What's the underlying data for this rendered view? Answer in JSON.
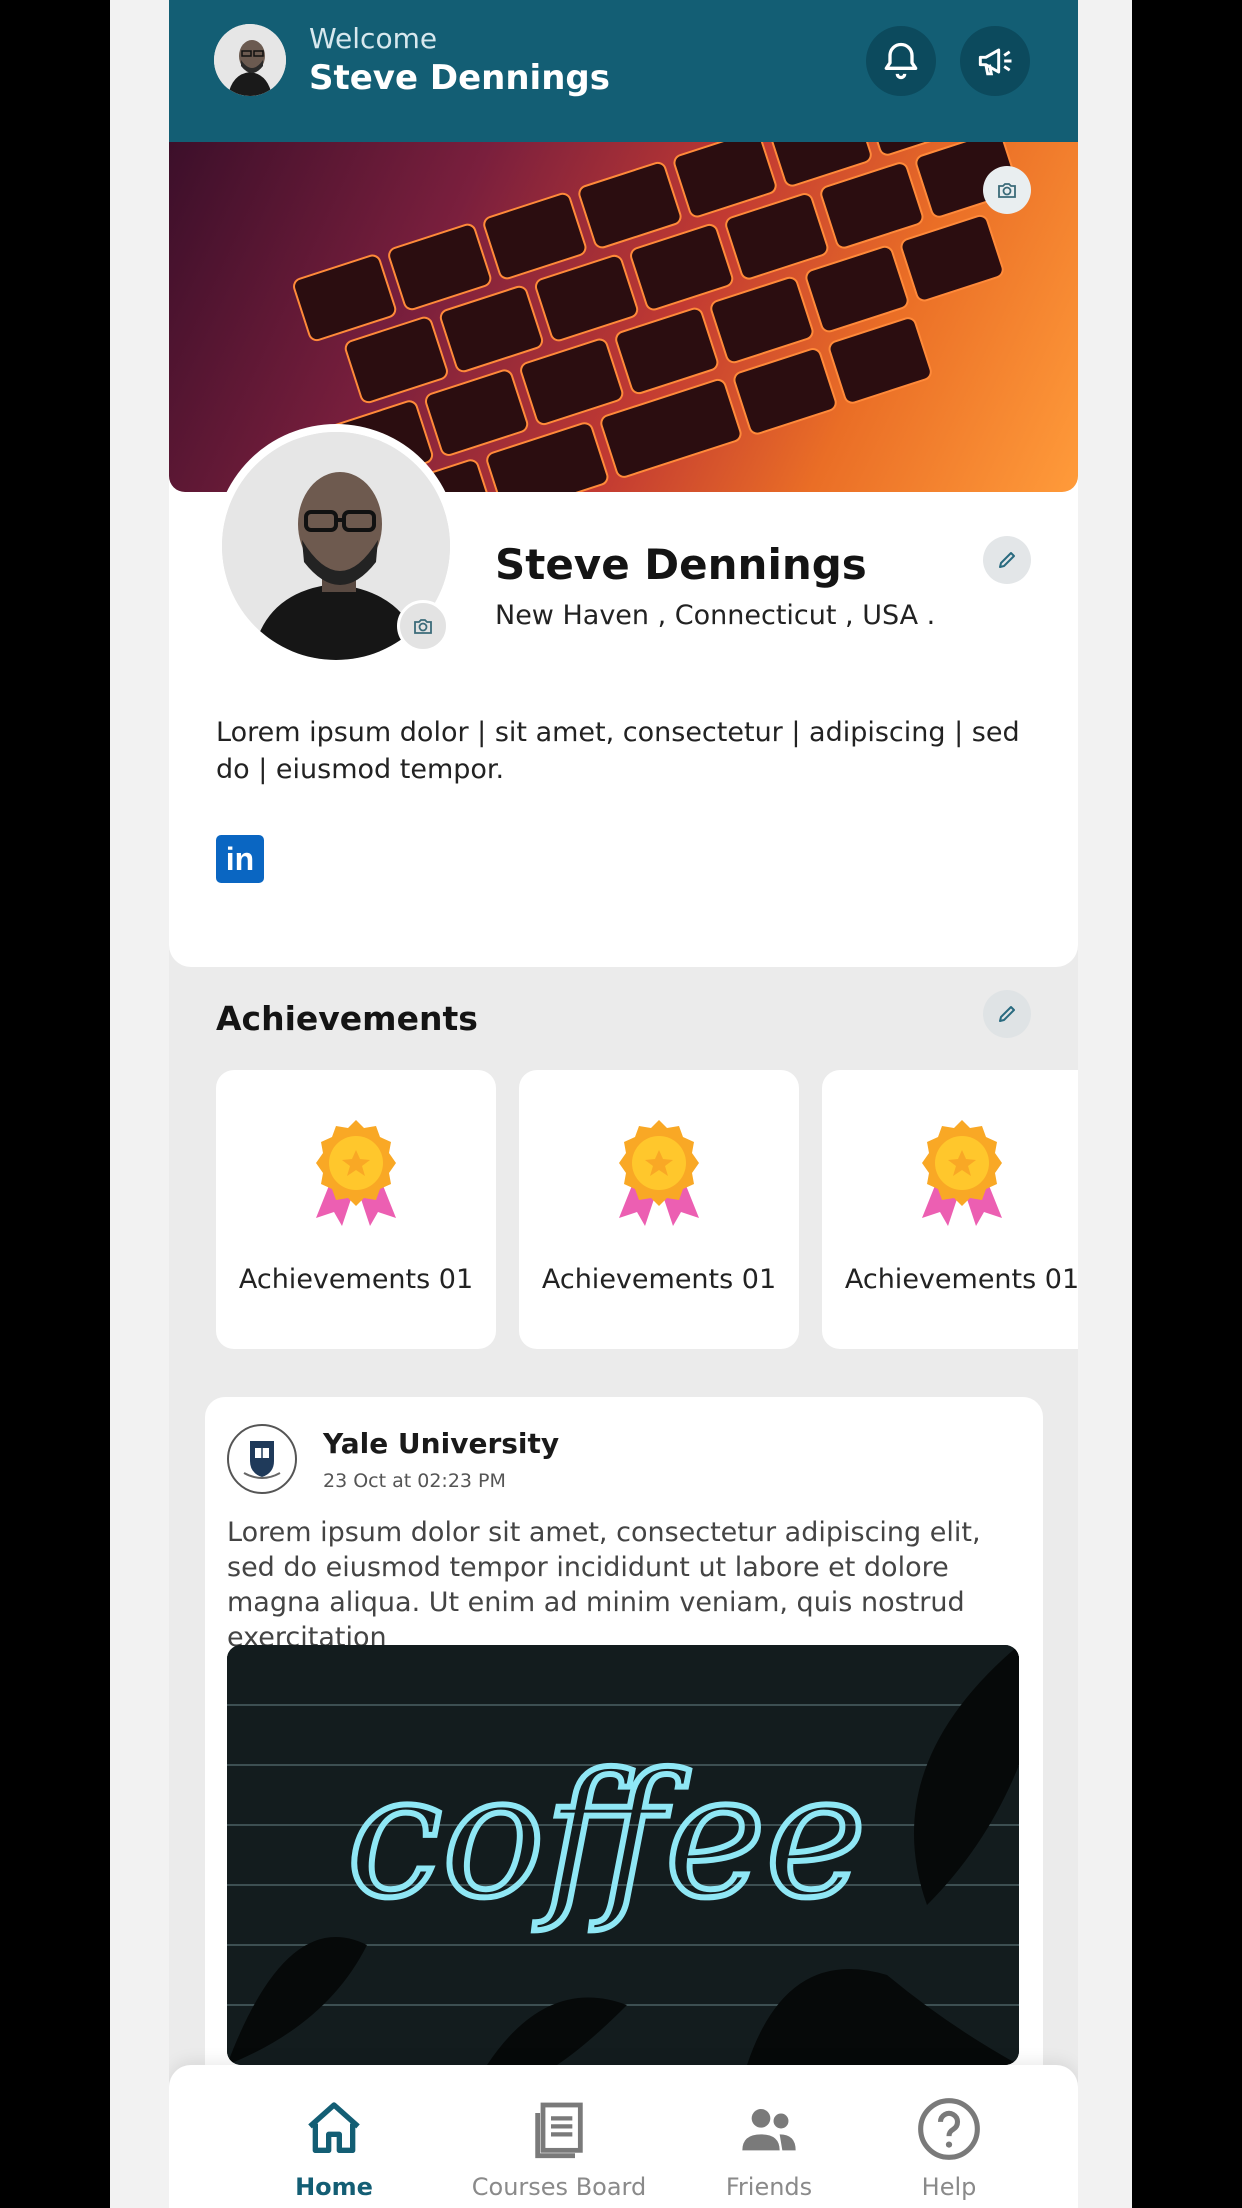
{
  "header": {
    "welcome": "Welcome",
    "user_name": "Steve Dennings",
    "icons": [
      "bell-icon",
      "megaphone-icon"
    ]
  },
  "profile": {
    "name": "Steve Dennings",
    "location": "New Haven , Connecticut , USA .",
    "bio": "Lorem ipsum dolor | sit amet, consectetur | adipiscing | sed do | eiusmod tempor.",
    "social": "in"
  },
  "achievements": {
    "title": "Achievements",
    "items": [
      {
        "label": "Achievements 01"
      },
      {
        "label": "Achievements 01"
      },
      {
        "label": "Achievements 01"
      }
    ]
  },
  "post": {
    "org": "Yale University",
    "time": "23  Oct at 02:23 PM",
    "text": "Lorem ipsum dolor sit amet, consectetur adipiscing elit, sed do eiusmod tempor incididunt ut labore et dolore magna aliqua. Ut enim ad minim veniam, quis nostrud exercitation",
    "image_text": "coffee"
  },
  "nav": {
    "items": [
      {
        "label": "Home",
        "icon": "home-icon",
        "active": true
      },
      {
        "label": "Courses Board",
        "icon": "courses-icon",
        "active": false
      },
      {
        "label": "Friends",
        "icon": "friends-icon",
        "active": false
      },
      {
        "label": "Help",
        "icon": "help-icon",
        "active": false
      }
    ]
  },
  "colors": {
    "primary": "#135e74",
    "background": "#ebebeb",
    "card": "#ffffff",
    "nav_inactive": "#8a8a8a"
  }
}
